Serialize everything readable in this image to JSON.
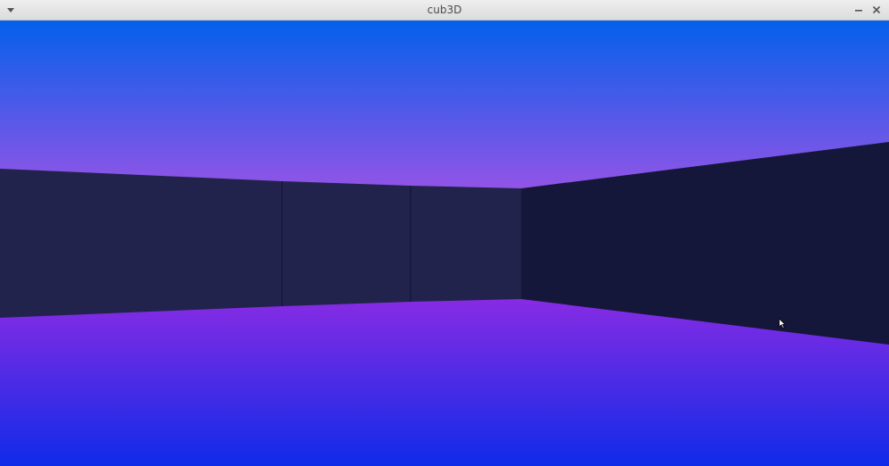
{
  "window": {
    "title": "cub3D",
    "menu_icon": "triangle-down-icon",
    "minimize_icon": "minimize-icon",
    "close_icon": "close-icon"
  },
  "scene": {
    "colors": {
      "sky_top": "#0460ea",
      "sky_bottom": "#c050e6",
      "floor_top": "#b62be2",
      "floor_bottom": "#0f2be8",
      "wall_lit": "#22234d",
      "wall_dark": "#15173a",
      "wall_seam": "#191a40"
    },
    "cursor_icon": "mouse-pointer-icon"
  }
}
